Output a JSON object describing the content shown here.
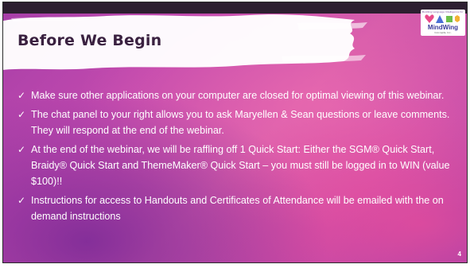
{
  "slide": {
    "title": "Before We Begin",
    "page_number": "4"
  },
  "logo": {
    "tagline": "Building Language Intelligence for Life Through",
    "name": "MindWing",
    "subtitle": "Concepts, Inc.",
    "colors": {
      "heart": "#e84a8a",
      "triangle": "#4a6fd6",
      "square": "#6cbf4a",
      "hexagon": "#f2b233",
      "text": "#3a3a9a"
    }
  },
  "bullets": [
    {
      "icon": "checkmark-icon",
      "text": "Make sure other applications on your computer are closed for optimal viewing of this webinar."
    },
    {
      "icon": "checkmark-icon",
      "text": "The chat panel to your right allows you to ask Maryellen & Sean questions or leave comments. They will respond at the end of the webinar."
    },
    {
      "icon": "checkmark-icon",
      "text": "At the end of the webinar, we will be raffling off 1 Quick Start: Either the SGM® Quick Start, Braidy® Quick Start and ThemeMaker® Quick Start – you must still be logged in to WIN (value $100)!!"
    },
    {
      "icon": "checkmark-icon",
      "text": "Instructions for access to Handouts and Certificates of Attendance will be emailed with the on demand instructions"
    }
  ],
  "colors": {
    "background_magenta": "#c24aae",
    "background_purple": "#9a3eaa",
    "brush_stroke": "#ffffff",
    "title_text": "#3a2140",
    "body_text": "#ffffff"
  }
}
